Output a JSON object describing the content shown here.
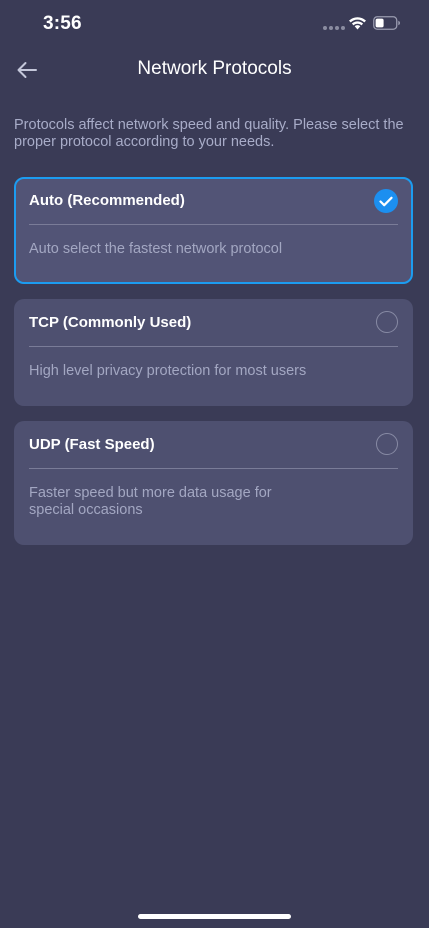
{
  "status_bar": {
    "time": "3:56"
  },
  "nav": {
    "title": "Network Protocols",
    "back_icon": "arrow-left-icon"
  },
  "intro": "Protocols affect network speed and quality. Please select the proper protocol according to your needs.",
  "options": [
    {
      "title": "Auto (Recommended)",
      "description": "Auto select the fastest network protocol",
      "selected": true
    },
    {
      "title": "TCP (Commonly Used)",
      "description": "High level privacy protection for most users",
      "selected": false
    },
    {
      "title": "UDP (Fast Speed)",
      "description": "Faster speed but more data usage for special occasions",
      "selected": false
    }
  ],
  "colors": {
    "background": "#3a3b56",
    "card": "#4e5070",
    "accent": "#1c9cf0",
    "muted_text": "#a8acc8"
  }
}
